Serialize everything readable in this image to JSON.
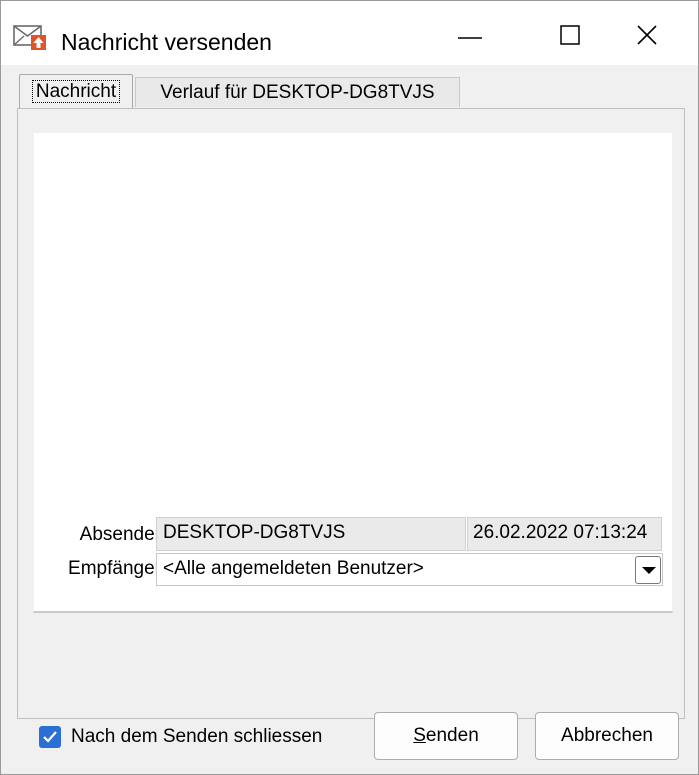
{
  "window": {
    "title": "Nachricht versenden",
    "app_icon": "envelope-upload-icon",
    "controls": [
      "minimize-icon",
      "maximize-icon",
      "close-icon"
    ]
  },
  "tabs": [
    {
      "label": "Nachricht",
      "active": true
    },
    {
      "label": "Verlauf für DESKTOP-DG8TVJS",
      "active": false
    }
  ],
  "message": {
    "text": ""
  },
  "absender": {
    "label": "Absender",
    "value": "DESKTOP-DG8TVJS",
    "timestamp": "26.02.2022 07:13:24"
  },
  "empfaenger": {
    "label": "Empfänger",
    "selected": "<Alle angemeldeten Benutzer>"
  },
  "footer": {
    "close_after_send_label": "Nach dem Senden schliessen",
    "close_after_send_checked": true,
    "send_label": "Senden",
    "cancel_label": "Abbrechen"
  },
  "colors": {
    "checkbox_accent": "#2a6fd6",
    "icon_accent": "#e0542a"
  }
}
